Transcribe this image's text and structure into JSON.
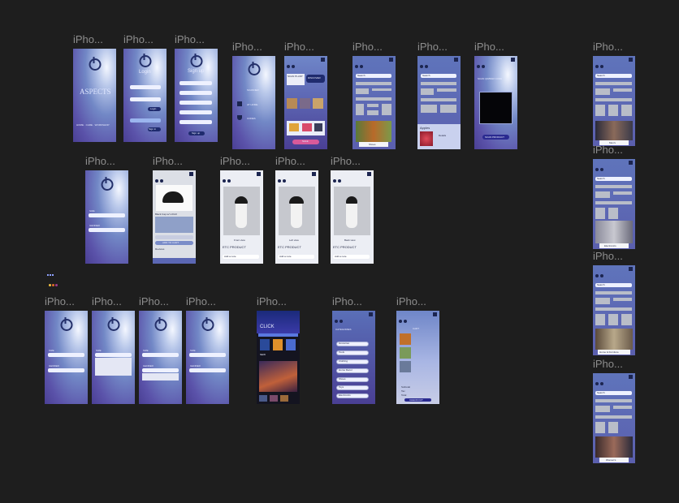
{
  "canvas": {
    "background": "#1e1e1e"
  },
  "frame_label": "iPho...",
  "frames": {
    "splash": {
      "brand": "ASPECTS",
      "footer": "HOME · CARE · WORKSHOP"
    },
    "login": {
      "title": "Login",
      "button": "Login",
      "alt": "Sign in"
    },
    "signup": {
      "title": "Sign up",
      "button": "Sign up"
    },
    "menu": {
      "items": [
        "SCANNER",
        "AT HOME",
        "CODES"
      ]
    },
    "shop": {
      "badge": "SCAN PLANT",
      "buy": "DISCOVER",
      "promo": "SALE"
    },
    "grid1": {
      "search": "Search",
      "caption": "Shoes"
    },
    "grid2": {
      "search": "Search",
      "item_title": "Apples",
      "item_text": "Details"
    },
    "qr": {
      "title": "SCAN QR/BAR CODE",
      "button": "SCAN PRODUCT"
    },
    "cap_detail": {
      "title": "Black Cap w/ LOGO",
      "button": "ADD TO CART",
      "meta": "Reviews"
    },
    "cap_views": [
      {
        "caption": "Front view",
        "sub": "ETC PRODUCT",
        "field": "Add a note"
      },
      {
        "caption": "Left view",
        "sub": "ETC PRODUCT",
        "field": "Add a note"
      },
      {
        "caption": "Back view",
        "sub": "ETC PRODUCT",
        "field": "Add a note"
      }
    ],
    "filters": {
      "a": "SIZE",
      "b": "GENDER"
    },
    "click": {
      "title": "CLICK",
      "tag": "NEW"
    },
    "categories": {
      "title": "CATEGORIES",
      "items": [
        "Groceries",
        "Tools",
        "Clothing",
        "Home Decor",
        "Shoes",
        "Toys",
        "Electronics"
      ]
    },
    "cart": {
      "title": "CART",
      "lines": [
        "Subtotal",
        "Tax",
        "Total"
      ],
      "button": "CHECKOUT"
    },
    "side": [
      {
        "search": "Search",
        "caption": "Men's"
      },
      {
        "search": "Search",
        "caption": "Electronics"
      },
      {
        "search": "Search",
        "caption": "Home & Furniture"
      },
      {
        "search": "Search",
        "caption": "Women's"
      }
    ]
  }
}
